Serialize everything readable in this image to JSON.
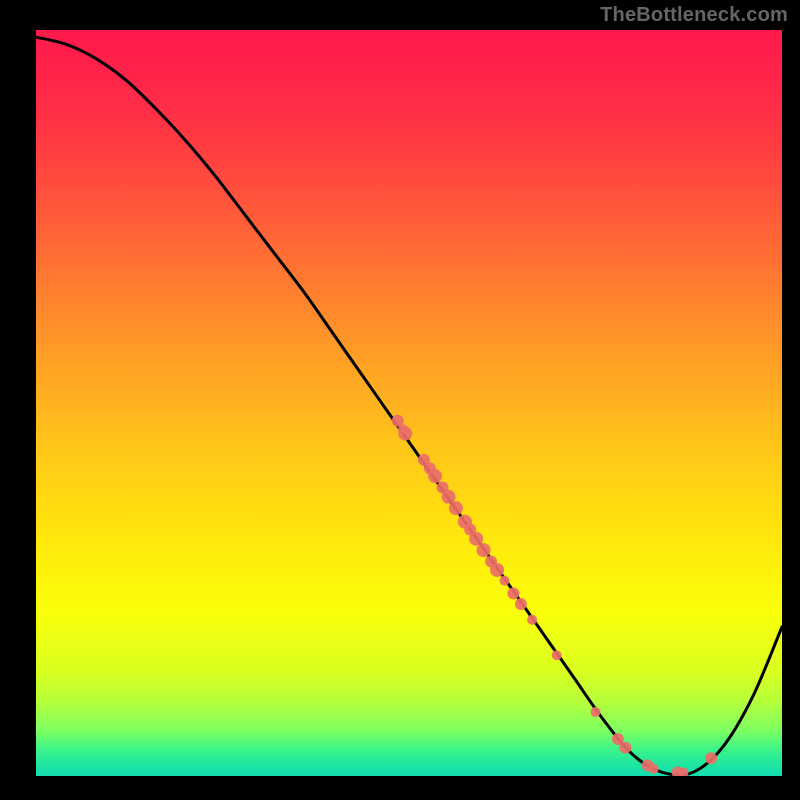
{
  "watermark": "TheBottleneck.com",
  "chart_data": {
    "type": "line",
    "title": "",
    "xlabel": "",
    "ylabel": "",
    "xlim": [
      0,
      100
    ],
    "ylim": [
      0,
      105
    ],
    "grid": false,
    "series": [
      {
        "name": "curve",
        "x": [
          0,
          4,
          8,
          12,
          16,
          20,
          24,
          28,
          32,
          36,
          40,
          44,
          48,
          52,
          56,
          60,
          64,
          68,
          72,
          76,
          80,
          84,
          88,
          92,
          96,
          100
        ],
        "y": [
          104,
          103,
          101,
          98,
          94,
          89.5,
          84.5,
          79,
          73.5,
          68,
          62,
          56,
          50,
          44,
          38,
          32,
          26,
          20,
          14,
          8,
          3,
          0.5,
          0.5,
          4,
          11,
          21
        ]
      }
    ],
    "points": [
      {
        "x": 48.5,
        "y": 50,
        "r": 6
      },
      {
        "x": 49.2,
        "y": 48.8,
        "r": 5
      },
      {
        "x": 49.5,
        "y": 48.2,
        "r": 7
      },
      {
        "x": 52,
        "y": 44.5,
        "r": 6
      },
      {
        "x": 52.8,
        "y": 43.3,
        "r": 6
      },
      {
        "x": 53.5,
        "y": 42.2,
        "r": 7
      },
      {
        "x": 54.5,
        "y": 40.6,
        "r": 6
      },
      {
        "x": 55.3,
        "y": 39.3,
        "r": 7
      },
      {
        "x": 56.3,
        "y": 37.7,
        "r": 7
      },
      {
        "x": 57.5,
        "y": 35.8,
        "r": 7
      },
      {
        "x": 58.2,
        "y": 34.7,
        "r": 6
      },
      {
        "x": 59,
        "y": 33.4,
        "r": 7
      },
      {
        "x": 60,
        "y": 31.8,
        "r": 7
      },
      {
        "x": 61,
        "y": 30.2,
        "r": 6
      },
      {
        "x": 61.8,
        "y": 29.0,
        "r": 7
      },
      {
        "x": 62.8,
        "y": 27.5,
        "r": 5
      },
      {
        "x": 64,
        "y": 25.7,
        "r": 6
      },
      {
        "x": 65,
        "y": 24.2,
        "r": 6
      },
      {
        "x": 66.5,
        "y": 22.0,
        "r": 5
      },
      {
        "x": 69.8,
        "y": 17.0,
        "r": 5
      },
      {
        "x": 75,
        "y": 9.0,
        "r": 5
      },
      {
        "x": 78,
        "y": 5.2,
        "r": 6
      },
      {
        "x": 79,
        "y": 4.0,
        "r": 6
      },
      {
        "x": 82,
        "y": 1.5,
        "r": 6
      },
      {
        "x": 82.8,
        "y": 1.0,
        "r": 5
      },
      {
        "x": 86,
        "y": 0.5,
        "r": 6
      },
      {
        "x": 86.8,
        "y": 0.5,
        "r": 5
      },
      {
        "x": 90.5,
        "y": 2.5,
        "r": 6
      }
    ],
    "gradient_stops": [
      {
        "pos": 0.0,
        "color": "#ff1a4c"
      },
      {
        "pos": 0.06,
        "color": "#ff234a"
      },
      {
        "pos": 0.12,
        "color": "#ff3245"
      },
      {
        "pos": 0.2,
        "color": "#ff4a3e"
      },
      {
        "pos": 0.3,
        "color": "#ff6d34"
      },
      {
        "pos": 0.42,
        "color": "#ff9828"
      },
      {
        "pos": 0.55,
        "color": "#ffc31a"
      },
      {
        "pos": 0.68,
        "color": "#ffe70c"
      },
      {
        "pos": 0.78,
        "color": "#faff0a"
      },
      {
        "pos": 0.86,
        "color": "#d9ff20"
      },
      {
        "pos": 0.9,
        "color": "#b6ff3a"
      },
      {
        "pos": 0.94,
        "color": "#7aff61"
      },
      {
        "pos": 0.965,
        "color": "#3cf48a"
      },
      {
        "pos": 0.985,
        "color": "#1ee5a0"
      },
      {
        "pos": 1.0,
        "color": "#14dcb0"
      }
    ],
    "point_color": "#ec6e68",
    "curve_color": "#000000"
  }
}
